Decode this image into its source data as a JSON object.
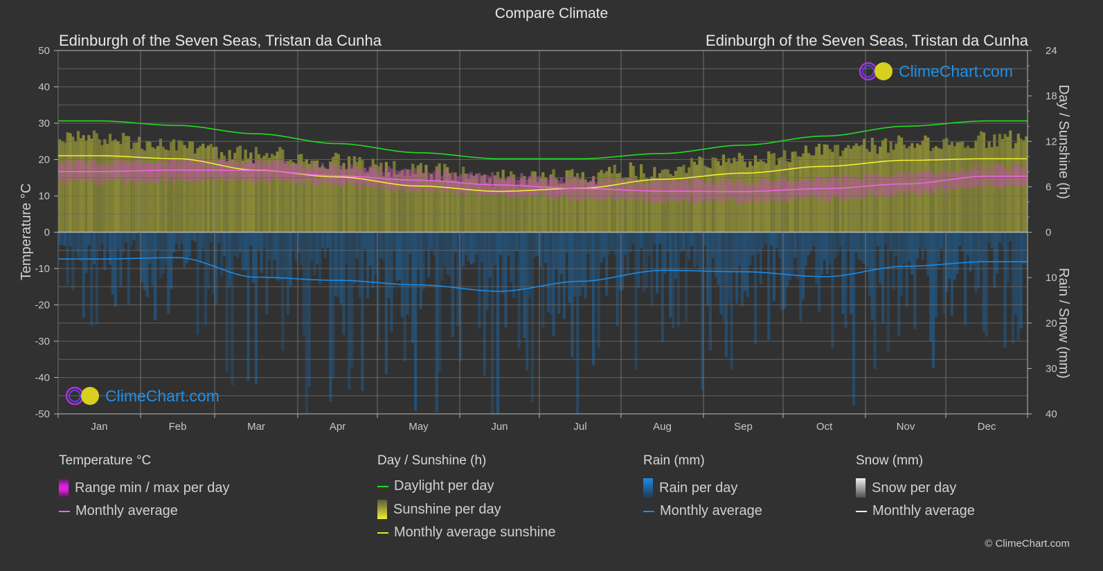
{
  "title": "Compare Climate",
  "location_left": "Edinburgh of the Seven Seas,  Tristan da Cunha",
  "location_right": "Edinburgh of the Seven Seas,  Tristan da Cunha",
  "logo_text": "ClimeChart.com",
  "copyright": "© ClimeChart.com",
  "colors": {
    "background": "#313131",
    "daylight": "#22dd22",
    "sunshine_avg": "#f0f030",
    "sunshine_fill": "#8c8c32",
    "temp_avg": "#ee66dd",
    "temp_range": "#cc44bb",
    "rain_avg": "#1a8ce8",
    "rain_fill": "#1f5a8a",
    "logo": "#1e90e8"
  },
  "chart_data": {
    "type": "line",
    "title": "Compare Climate",
    "categories": [
      "Jan",
      "Feb",
      "Mar",
      "Apr",
      "May",
      "Jun",
      "Jul",
      "Aug",
      "Sep",
      "Oct",
      "Nov",
      "Dec"
    ],
    "axes": {
      "left": {
        "label": "Temperature °C",
        "range": [
          -50,
          50
        ],
        "ticks": [
          "50",
          "40",
          "30",
          "20",
          "10",
          "0",
          "-10",
          "-20",
          "-30",
          "-40",
          "-50"
        ]
      },
      "right_top": {
        "label": "Day / Sunshine (h)",
        "range": [
          0,
          24
        ],
        "ticks": [
          "24",
          "18",
          "12",
          "6",
          "0"
        ]
      },
      "right_bottom": {
        "label": "Rain / Snow (mm)",
        "range": [
          0,
          40
        ],
        "ticks": [
          "0",
          "10",
          "20",
          "30",
          "40"
        ]
      }
    },
    "grid": true,
    "series": [
      {
        "name": "Daylight per day",
        "axis": "sunshine_h",
        "values": [
          14.7,
          14.1,
          13.0,
          11.7,
          10.5,
          9.7,
          9.7,
          10.4,
          11.5,
          12.7,
          14.0,
          14.7
        ]
      },
      {
        "name": "Monthly average sunshine",
        "axis": "sunshine_h",
        "values": [
          10.1,
          9.7,
          8.2,
          7.3,
          6.1,
          5.4,
          5.8,
          7.0,
          7.8,
          8.7,
          9.5,
          9.7
        ]
      },
      {
        "name": "Sunshine per day (top of band)",
        "axis": "sunshine_h",
        "values": [
          13.5,
          12.3,
          11.5,
          10.5,
          9.3,
          8.4,
          8.6,
          9.6,
          10.7,
          11.9,
          12.9,
          13.5
        ]
      },
      {
        "name": "Temperature monthly average",
        "axis": "temp_c",
        "values": [
          16.7,
          17.1,
          17.0,
          15.5,
          14.3,
          13.0,
          12.0,
          11.3,
          11.2,
          12.0,
          13.3,
          15.4
        ]
      },
      {
        "name": "Temperature range max",
        "axis": "temp_c",
        "values": [
          19.5,
          19.8,
          19.5,
          18.0,
          16.8,
          15.5,
          14.5,
          14.0,
          14.0,
          14.8,
          16.0,
          18.0
        ]
      },
      {
        "name": "Temperature range min",
        "axis": "temp_c",
        "values": [
          14.0,
          14.4,
          14.5,
          13.0,
          11.8,
          10.5,
          9.5,
          8.7,
          8.5,
          9.2,
          10.6,
          12.8
        ]
      },
      {
        "name": "Rain monthly average",
        "axis": "rain_mm",
        "values": [
          5.9,
          5.6,
          9.9,
          10.6,
          11.6,
          13.0,
          10.8,
          8.4,
          8.7,
          9.8,
          7.5,
          6.5
        ]
      }
    ],
    "legend": {
      "placement": "bottom",
      "groups": [
        {
          "title": "Temperature °C",
          "items": [
            {
              "label": "Range min / max per day",
              "swatch": "box",
              "color": "#e020e0"
            },
            {
              "label": "Monthly average",
              "swatch": "line",
              "color": "#ee66dd"
            }
          ]
        },
        {
          "title": "Day / Sunshine (h)",
          "items": [
            {
              "label": "Daylight per day",
              "swatch": "line",
              "color": "#22dd22"
            },
            {
              "label": "Sunshine per day",
              "swatch": "box",
              "color": "#e6e62a"
            },
            {
              "label": "Monthly average sunshine",
              "swatch": "line",
              "color": "#e6e62a"
            }
          ]
        },
        {
          "title": "Rain (mm)",
          "items": [
            {
              "label": "Rain per day",
              "swatch": "box",
              "color": "#1a8ce8"
            },
            {
              "label": "Monthly average",
              "swatch": "line",
              "color": "#1a8ce8"
            }
          ]
        },
        {
          "title": "Snow (mm)",
          "items": [
            {
              "label": "Snow per day",
              "swatch": "box",
              "color": "#e0e0e0"
            },
            {
              "label": "Monthly average",
              "swatch": "line",
              "color": "#f0f0f0"
            }
          ]
        }
      ]
    }
  }
}
